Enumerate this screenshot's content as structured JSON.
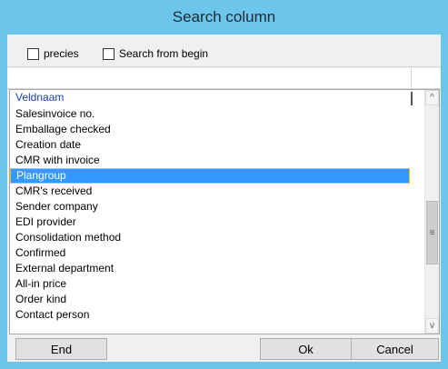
{
  "window": {
    "title": "Search column"
  },
  "options": {
    "precies_label": "precies",
    "search_from_begin_label": "Search from begin"
  },
  "filter": {
    "value": ""
  },
  "list": {
    "header": "Veldnaam",
    "items": [
      "Salesinvoice no.",
      "Emballage checked",
      "Creation date",
      "CMR with invoice",
      "Plangroup",
      "CMR's received",
      "Sender company",
      "EDI provider",
      "Consolidation method",
      "Confirmed",
      "External department",
      "All-in price",
      "Order kind",
      "Contact person"
    ],
    "selected": "Plangroup"
  },
  "scrollbar": {
    "up_glyph": "^",
    "down_glyph": "v",
    "thumb_glyph": "≡"
  },
  "buttons": {
    "end": "End",
    "ok": "Ok",
    "cancel": "Cancel"
  },
  "colors": {
    "titlebar": "#6cc5ea",
    "selection": "#3399ff",
    "header_text": "#1a3fb0"
  }
}
